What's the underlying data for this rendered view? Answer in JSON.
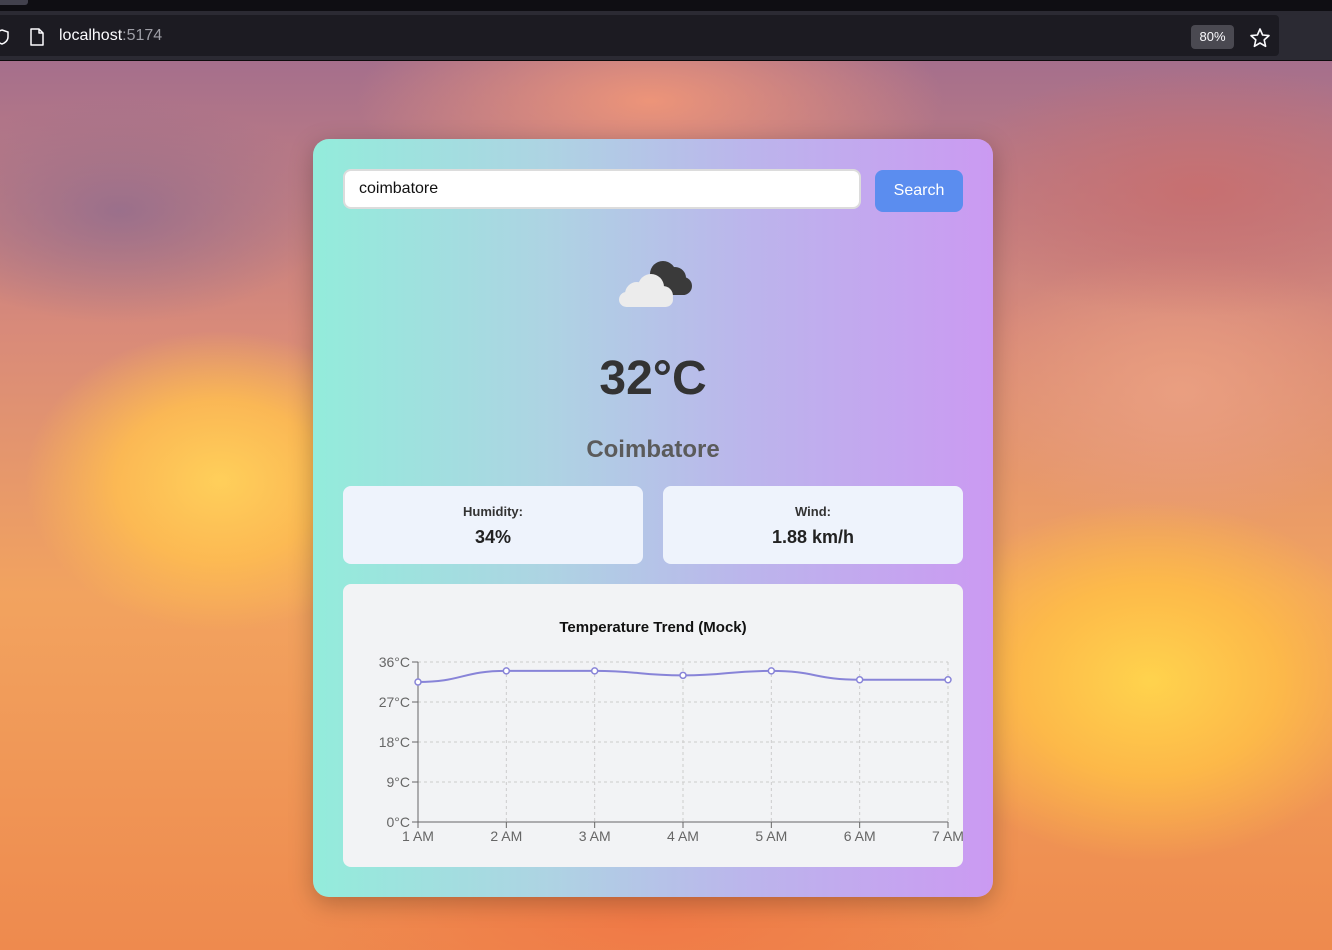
{
  "browser": {
    "url_host": "localhost",
    "url_port": ":5174",
    "zoom": "80%"
  },
  "search": {
    "value": "coimbatore",
    "button_label": "Search"
  },
  "weather": {
    "icon": "cloudy-icon",
    "temperature": "32°C",
    "city": "Coimbatore",
    "humidity_label": "Humidity:",
    "humidity_value": "34%",
    "wind_label": "Wind:",
    "wind_value": "1.88 km/h"
  },
  "colors": {
    "search_button": "#5b8def",
    "chart_line": "#8884d8",
    "card_gradient_start": "#93ecdb",
    "card_gradient_end": "#cb9af2"
  },
  "chart_data": {
    "type": "line",
    "title": "Temperature Trend (Mock)",
    "categories": [
      "1 AM",
      "2 AM",
      "3 AM",
      "4 AM",
      "5 AM",
      "6 AM",
      "7 AM"
    ],
    "series": [
      {
        "values": [
          31.5,
          34,
          34,
          33,
          34,
          32,
          32
        ]
      }
    ],
    "y_ticks": [
      "0°C",
      "9°C",
      "18°C",
      "27°C",
      "36°C"
    ],
    "y_tick_values": [
      0,
      9,
      18,
      27,
      36
    ],
    "ylim": [
      0,
      36
    ],
    "grid": true
  }
}
